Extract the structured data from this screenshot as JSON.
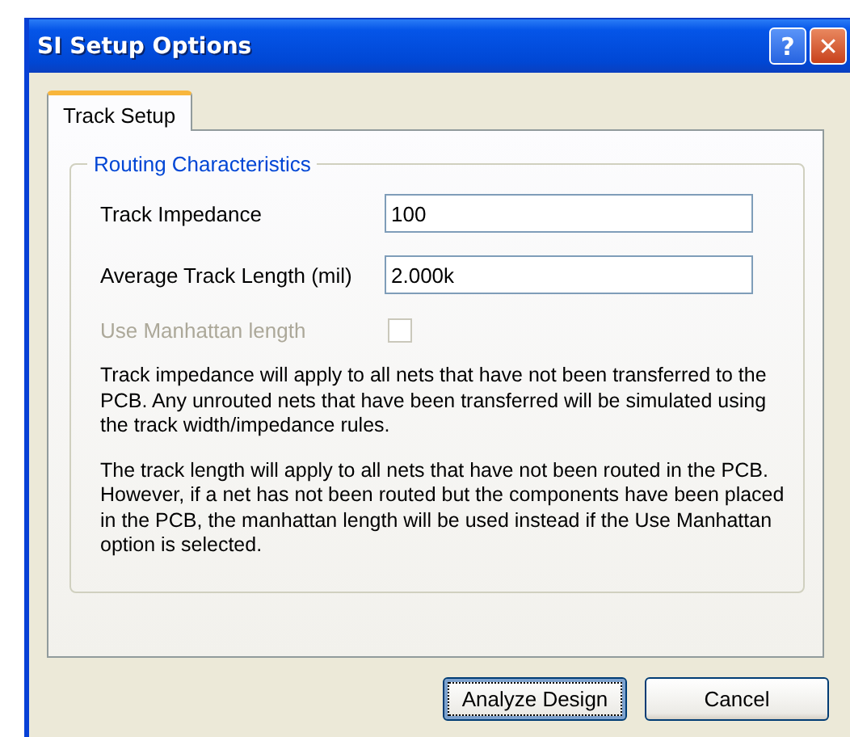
{
  "window": {
    "title": "SI Setup Options",
    "help_button": "?",
    "close_button": "✕"
  },
  "tabs": [
    {
      "label": "Track Setup",
      "selected": true
    }
  ],
  "group": {
    "title": "Routing Characteristics"
  },
  "fields": [
    {
      "label": "Track Impedance",
      "value": "100"
    },
    {
      "label": "Average Track Length (mil)",
      "value": "2.000k"
    }
  ],
  "checkbox": {
    "label": "Use Manhattan length",
    "checked": false,
    "disabled": true
  },
  "paragraphs": [
    "Track impedance will apply to all nets that have not been transferred to the PCB.  Any unrouted nets that have been transferred will be simulated using the track width/impedance rules.",
    "The track length will apply to all nets that have not been routed in the PCB.  However, if a net has not been routed but the components have been placed in the PCB, the manhattan length will be used instead if the Use Manhattan option is selected."
  ],
  "buttons": [
    {
      "label": "Analyze Design",
      "focused": true
    },
    {
      "label": "Cancel",
      "focused": false
    }
  ]
}
